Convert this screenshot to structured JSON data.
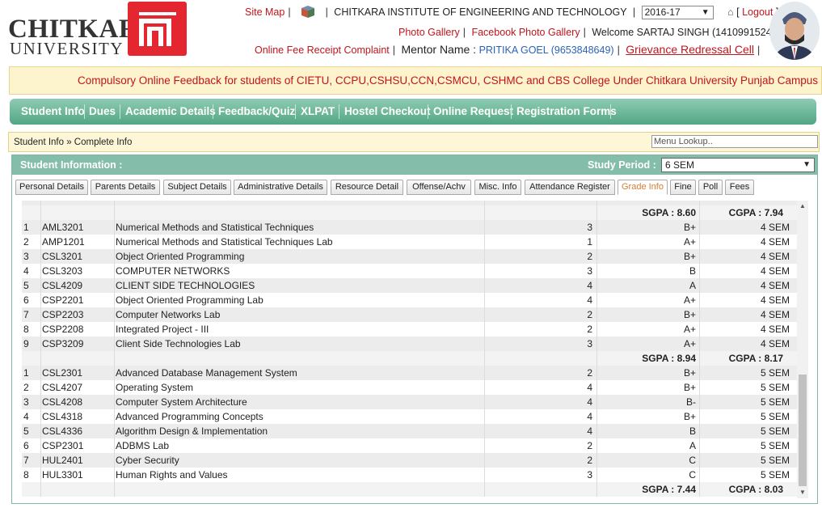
{
  "logo": {
    "line1": "CHITKARA",
    "line2": "UNIVERSITY"
  },
  "header": {
    "site_map": "Site Map",
    "institute": "CHITKARA INSTITUTE OF ENGINEERING AND TECHNOLOGY",
    "year": "2016-17",
    "logout": "Logout",
    "photo_gallery": "Photo Gallery",
    "facebook_gallery": "Facebook Photo Gallery",
    "welcome": "Welcome SARTAJ SINGH (1410991524)",
    "fee_complaint": "Online Fee Receipt Complaint",
    "mentor_label": "Mentor Name :",
    "mentor_value": "PRITIKA GOEL (9653848649)",
    "grievance": "Grievance Redressal Cell"
  },
  "notice": "Compulsory Online Feedback for students of CIETU, CCPU,CSHSU,CCN,CSMCU, CSHMC and CBS College Under Chitkara University Punjab Campus is ope",
  "nav": [
    "Student Info",
    "Dues",
    "Academic Details",
    "Feedback/Quiz",
    "XLPAT",
    "Hostel Checkout",
    "Online Request",
    "Registration Forms"
  ],
  "breadcrumb": "Student Info » Complete Info",
  "menu_lookup_placeholder": "Menu Lookup..",
  "panel": {
    "title": "Student Information :",
    "study_period_label": "Study Period :",
    "study_period_value": "6 SEM"
  },
  "tabs": [
    "Personal Details",
    "Parents Details",
    "Subject Details",
    "Administrative Details",
    "Resource Detail",
    "Offense/Achv",
    "Misc. Info",
    "Attendance Register",
    "Grade Info",
    "Fine",
    "Poll",
    "Fees"
  ],
  "active_tab": "Grade Info",
  "grades": {
    "sum1": {
      "sgpa": "SGPA :  8.60",
      "cgpa": "CGPA :  7.94"
    },
    "sem4": [
      {
        "n": "1",
        "code": "AML3201",
        "title": "Numerical Methods and Statistical Techniques",
        "credits": "3",
        "grade": "B+",
        "sem": "4 SEM"
      },
      {
        "n": "2",
        "code": "AMP1201",
        "title": "Numerical Methods and Statistical Techniques Lab",
        "credits": "1",
        "grade": "A+",
        "sem": "4 SEM"
      },
      {
        "n": "3",
        "code": "CSL3201",
        "title": "Object Oriented Programming",
        "credits": "2",
        "grade": "B+",
        "sem": "4 SEM"
      },
      {
        "n": "4",
        "code": "CSL3203",
        "title": "COMPUTER NETWORKS",
        "credits": "3",
        "grade": "B",
        "sem": "4 SEM"
      },
      {
        "n": "5",
        "code": "CSL4209",
        "title": "CLIENT SIDE TECHNOLOGIES",
        "credits": "4",
        "grade": "A",
        "sem": "4 SEM"
      },
      {
        "n": "6",
        "code": "CSP2201",
        "title": "Object Oriented Programming Lab",
        "credits": "4",
        "grade": "A+",
        "sem": "4 SEM"
      },
      {
        "n": "7",
        "code": "CSP2203",
        "title": "Computer Networks Lab",
        "credits": "2",
        "grade": "B+",
        "sem": "4 SEM"
      },
      {
        "n": "8",
        "code": "CSP2208",
        "title": "Integrated Project - III",
        "credits": "2",
        "grade": "A+",
        "sem": "4 SEM"
      },
      {
        "n": "9",
        "code": "CSP3209",
        "title": "Client Side Technologies Lab",
        "credits": "3",
        "grade": "A+",
        "sem": "4 SEM"
      }
    ],
    "sum2": {
      "sgpa": "SGPA :  8.94",
      "cgpa": "CGPA :  8.17"
    },
    "sem5": [
      {
        "n": "1",
        "code": "CSL2301",
        "title": "Advanced Database Management System",
        "credits": "2",
        "grade": "B+",
        "sem": "5 SEM"
      },
      {
        "n": "2",
        "code": "CSL4207",
        "title": "Operating System",
        "credits": "4",
        "grade": "B+",
        "sem": "5 SEM"
      },
      {
        "n": "3",
        "code": "CSL4208",
        "title": "Computer System Architecture",
        "credits": "4",
        "grade": "B-",
        "sem": "5 SEM"
      },
      {
        "n": "4",
        "code": "CSL4318",
        "title": "Advanced Programming Concepts",
        "credits": "4",
        "grade": "B+",
        "sem": "5 SEM"
      },
      {
        "n": "5",
        "code": "CSL4336",
        "title": "Algorithm Design & Implementation",
        "credits": "4",
        "grade": "B",
        "sem": "5 SEM"
      },
      {
        "n": "6",
        "code": "CSP2301",
        "title": "ADBMS Lab",
        "credits": "2",
        "grade": "A",
        "sem": "5 SEM"
      },
      {
        "n": "7",
        "code": "HUL2401",
        "title": "Cyber Security",
        "credits": "2",
        "grade": "C",
        "sem": "5 SEM"
      },
      {
        "n": "8",
        "code": "HUL3301",
        "title": "Human Rights and Values",
        "credits": "3",
        "grade": "C",
        "sem": "5 SEM"
      }
    ],
    "sum3": {
      "sgpa": "SGPA :  7.44",
      "cgpa": "CGPA :  8.03"
    }
  },
  "colors": {
    "brand_red": "#e3262f",
    "nav_green": "#52a684",
    "panel_green": "#84bda9",
    "active_tab": "#d47f35"
  }
}
